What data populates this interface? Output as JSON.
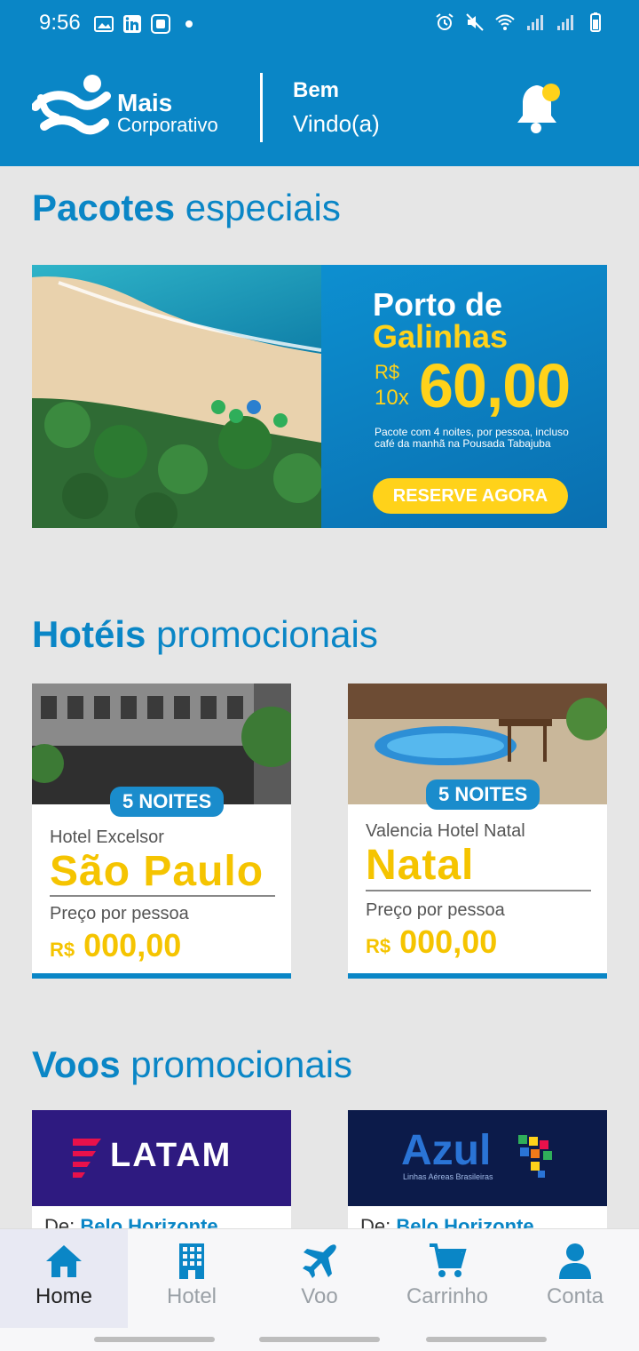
{
  "status_bar": {
    "time": "9:56"
  },
  "header": {
    "logo_line1": "Mais",
    "logo_line2": "Corporativo",
    "welcome_line1": "Bem",
    "welcome_line2": "Vindo(a)"
  },
  "sections": {
    "packages": {
      "title_bold": "Pacotes",
      "title_rest": "especiais"
    },
    "hotels": {
      "title_bold": "Hotéis",
      "title_rest": "promocionais"
    },
    "flights": {
      "title_bold": "Voos",
      "title_rest": "promocionais"
    }
  },
  "banner": {
    "title_line1": "Porto de",
    "title_line2": "Galinhas",
    "currency": "R$",
    "installments": "10x",
    "price": "60,00",
    "description": "Pacote com 4 noites, por pessoa, incluso café da manhã na Pousada Tabajuba",
    "cta": "RESERVE AGORA"
  },
  "hotels": [
    {
      "badge": "5 NOITES",
      "name": "Hotel Excelsor",
      "city": "São Paulo",
      "price_label": "Preço por pessoa",
      "currency": "R$",
      "price": "000,00"
    },
    {
      "badge": "5 NOITES",
      "name": "Valencia Hotel Natal",
      "city": "Natal",
      "price_label": "Preço por pessoa",
      "currency": "R$",
      "price": "000,00"
    }
  ],
  "flights": [
    {
      "airline": "LATAM",
      "route_prefix": "De:",
      "route_city": "Belo Horizonte"
    },
    {
      "airline": "Azul",
      "airline_sub": "Linhas Aéreas Brasileiras",
      "route_prefix": "De:",
      "route_city": "Belo Horizonte"
    }
  ],
  "bottom_nav": [
    {
      "label": "Home",
      "icon": "home-icon",
      "active": true
    },
    {
      "label": "Hotel",
      "icon": "building-icon",
      "active": false
    },
    {
      "label": "Voo",
      "icon": "airplane-icon",
      "active": false
    },
    {
      "label": "Carrinho",
      "icon": "cart-icon",
      "active": false
    },
    {
      "label": "Conta",
      "icon": "person-icon",
      "active": false
    }
  ],
  "colors": {
    "primary": "#0a86c6",
    "accent": "#ffd21a",
    "background": "#e6e6e6"
  }
}
